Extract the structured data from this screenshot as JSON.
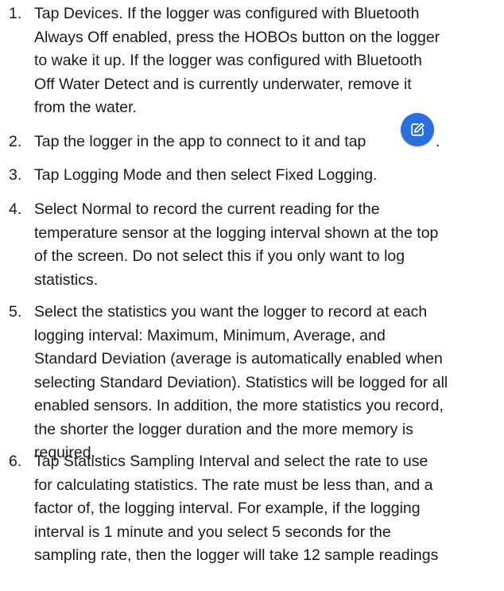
{
  "steps": [
    {
      "number": "1.",
      "lines": [
        "Tap Devices. If the logger was configured with Bluetooth",
        "Always Off enabled, press the HOBOs button on the logger",
        "to wake it up. If the logger was configured with Bluetooth",
        "Off Water Detect and is currently underwater, remove it",
        "from the water."
      ]
    },
    {
      "number": "2.",
      "lines": [
        "Tap the logger in the app to connect to it and tap"
      ],
      "trailing": "."
    },
    {
      "number": "3.",
      "lines": [
        "Tap Logging Mode and then select Fixed Logging."
      ]
    },
    {
      "number": "4.",
      "lines": [
        "Select Normal to record the current reading for the",
        "temperature sensor at the logging interval shown at the top",
        "of the screen. Do not select this if you only want to log",
        "statistics."
      ]
    },
    {
      "number": "5.",
      "lines": [
        "Select the statistics you want the logger to record at each",
        "logging interval: Maximum, Minimum, Average, and",
        "Standard Deviation (average is automatically enabled when",
        "selecting Standard Deviation). Statistics will be logged for all",
        "enabled sensors. In addition, the more statistics you record,",
        "the shorter the logger duration and the more memory is",
        "required."
      ]
    },
    {
      "number": "6.",
      "lines": [
        "Tap Statistics Sampling Interval and select the rate to use",
        "for calculating statistics. The rate must be less than, and a",
        "factor of, the logging interval. For example, if the logging",
        "interval is 1 minute and you select 5 seconds for the",
        "sampling rate, then the logger will take 12 sample readings"
      ]
    }
  ],
  "icons": {
    "edit": "edit-pencil-icon",
    "edit_bg": "#2a6fdb"
  }
}
